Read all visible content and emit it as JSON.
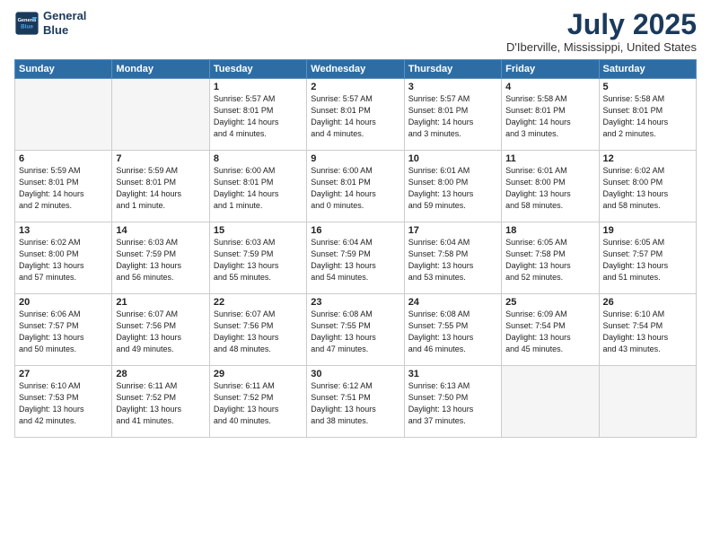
{
  "header": {
    "logo_line1": "General",
    "logo_line2": "Blue",
    "title": "July 2025",
    "subtitle": "D'Iberville, Mississippi, United States"
  },
  "weekdays": [
    "Sunday",
    "Monday",
    "Tuesday",
    "Wednesday",
    "Thursday",
    "Friday",
    "Saturday"
  ],
  "weeks": [
    [
      {
        "day": "",
        "info": ""
      },
      {
        "day": "",
        "info": ""
      },
      {
        "day": "1",
        "info": "Sunrise: 5:57 AM\nSunset: 8:01 PM\nDaylight: 14 hours\nand 4 minutes."
      },
      {
        "day": "2",
        "info": "Sunrise: 5:57 AM\nSunset: 8:01 PM\nDaylight: 14 hours\nand 4 minutes."
      },
      {
        "day": "3",
        "info": "Sunrise: 5:57 AM\nSunset: 8:01 PM\nDaylight: 14 hours\nand 3 minutes."
      },
      {
        "day": "4",
        "info": "Sunrise: 5:58 AM\nSunset: 8:01 PM\nDaylight: 14 hours\nand 3 minutes."
      },
      {
        "day": "5",
        "info": "Sunrise: 5:58 AM\nSunset: 8:01 PM\nDaylight: 14 hours\nand 2 minutes."
      }
    ],
    [
      {
        "day": "6",
        "info": "Sunrise: 5:59 AM\nSunset: 8:01 PM\nDaylight: 14 hours\nand 2 minutes."
      },
      {
        "day": "7",
        "info": "Sunrise: 5:59 AM\nSunset: 8:01 PM\nDaylight: 14 hours\nand 1 minute."
      },
      {
        "day": "8",
        "info": "Sunrise: 6:00 AM\nSunset: 8:01 PM\nDaylight: 14 hours\nand 1 minute."
      },
      {
        "day": "9",
        "info": "Sunrise: 6:00 AM\nSunset: 8:01 PM\nDaylight: 14 hours\nand 0 minutes."
      },
      {
        "day": "10",
        "info": "Sunrise: 6:01 AM\nSunset: 8:00 PM\nDaylight: 13 hours\nand 59 minutes."
      },
      {
        "day": "11",
        "info": "Sunrise: 6:01 AM\nSunset: 8:00 PM\nDaylight: 13 hours\nand 58 minutes."
      },
      {
        "day": "12",
        "info": "Sunrise: 6:02 AM\nSunset: 8:00 PM\nDaylight: 13 hours\nand 58 minutes."
      }
    ],
    [
      {
        "day": "13",
        "info": "Sunrise: 6:02 AM\nSunset: 8:00 PM\nDaylight: 13 hours\nand 57 minutes."
      },
      {
        "day": "14",
        "info": "Sunrise: 6:03 AM\nSunset: 7:59 PM\nDaylight: 13 hours\nand 56 minutes."
      },
      {
        "day": "15",
        "info": "Sunrise: 6:03 AM\nSunset: 7:59 PM\nDaylight: 13 hours\nand 55 minutes."
      },
      {
        "day": "16",
        "info": "Sunrise: 6:04 AM\nSunset: 7:59 PM\nDaylight: 13 hours\nand 54 minutes."
      },
      {
        "day": "17",
        "info": "Sunrise: 6:04 AM\nSunset: 7:58 PM\nDaylight: 13 hours\nand 53 minutes."
      },
      {
        "day": "18",
        "info": "Sunrise: 6:05 AM\nSunset: 7:58 PM\nDaylight: 13 hours\nand 52 minutes."
      },
      {
        "day": "19",
        "info": "Sunrise: 6:05 AM\nSunset: 7:57 PM\nDaylight: 13 hours\nand 51 minutes."
      }
    ],
    [
      {
        "day": "20",
        "info": "Sunrise: 6:06 AM\nSunset: 7:57 PM\nDaylight: 13 hours\nand 50 minutes."
      },
      {
        "day": "21",
        "info": "Sunrise: 6:07 AM\nSunset: 7:56 PM\nDaylight: 13 hours\nand 49 minutes."
      },
      {
        "day": "22",
        "info": "Sunrise: 6:07 AM\nSunset: 7:56 PM\nDaylight: 13 hours\nand 48 minutes."
      },
      {
        "day": "23",
        "info": "Sunrise: 6:08 AM\nSunset: 7:55 PM\nDaylight: 13 hours\nand 47 minutes."
      },
      {
        "day": "24",
        "info": "Sunrise: 6:08 AM\nSunset: 7:55 PM\nDaylight: 13 hours\nand 46 minutes."
      },
      {
        "day": "25",
        "info": "Sunrise: 6:09 AM\nSunset: 7:54 PM\nDaylight: 13 hours\nand 45 minutes."
      },
      {
        "day": "26",
        "info": "Sunrise: 6:10 AM\nSunset: 7:54 PM\nDaylight: 13 hours\nand 43 minutes."
      }
    ],
    [
      {
        "day": "27",
        "info": "Sunrise: 6:10 AM\nSunset: 7:53 PM\nDaylight: 13 hours\nand 42 minutes."
      },
      {
        "day": "28",
        "info": "Sunrise: 6:11 AM\nSunset: 7:52 PM\nDaylight: 13 hours\nand 41 minutes."
      },
      {
        "day": "29",
        "info": "Sunrise: 6:11 AM\nSunset: 7:52 PM\nDaylight: 13 hours\nand 40 minutes."
      },
      {
        "day": "30",
        "info": "Sunrise: 6:12 AM\nSunset: 7:51 PM\nDaylight: 13 hours\nand 38 minutes."
      },
      {
        "day": "31",
        "info": "Sunrise: 6:13 AM\nSunset: 7:50 PM\nDaylight: 13 hours\nand 37 minutes."
      },
      {
        "day": "",
        "info": ""
      },
      {
        "day": "",
        "info": ""
      }
    ]
  ]
}
